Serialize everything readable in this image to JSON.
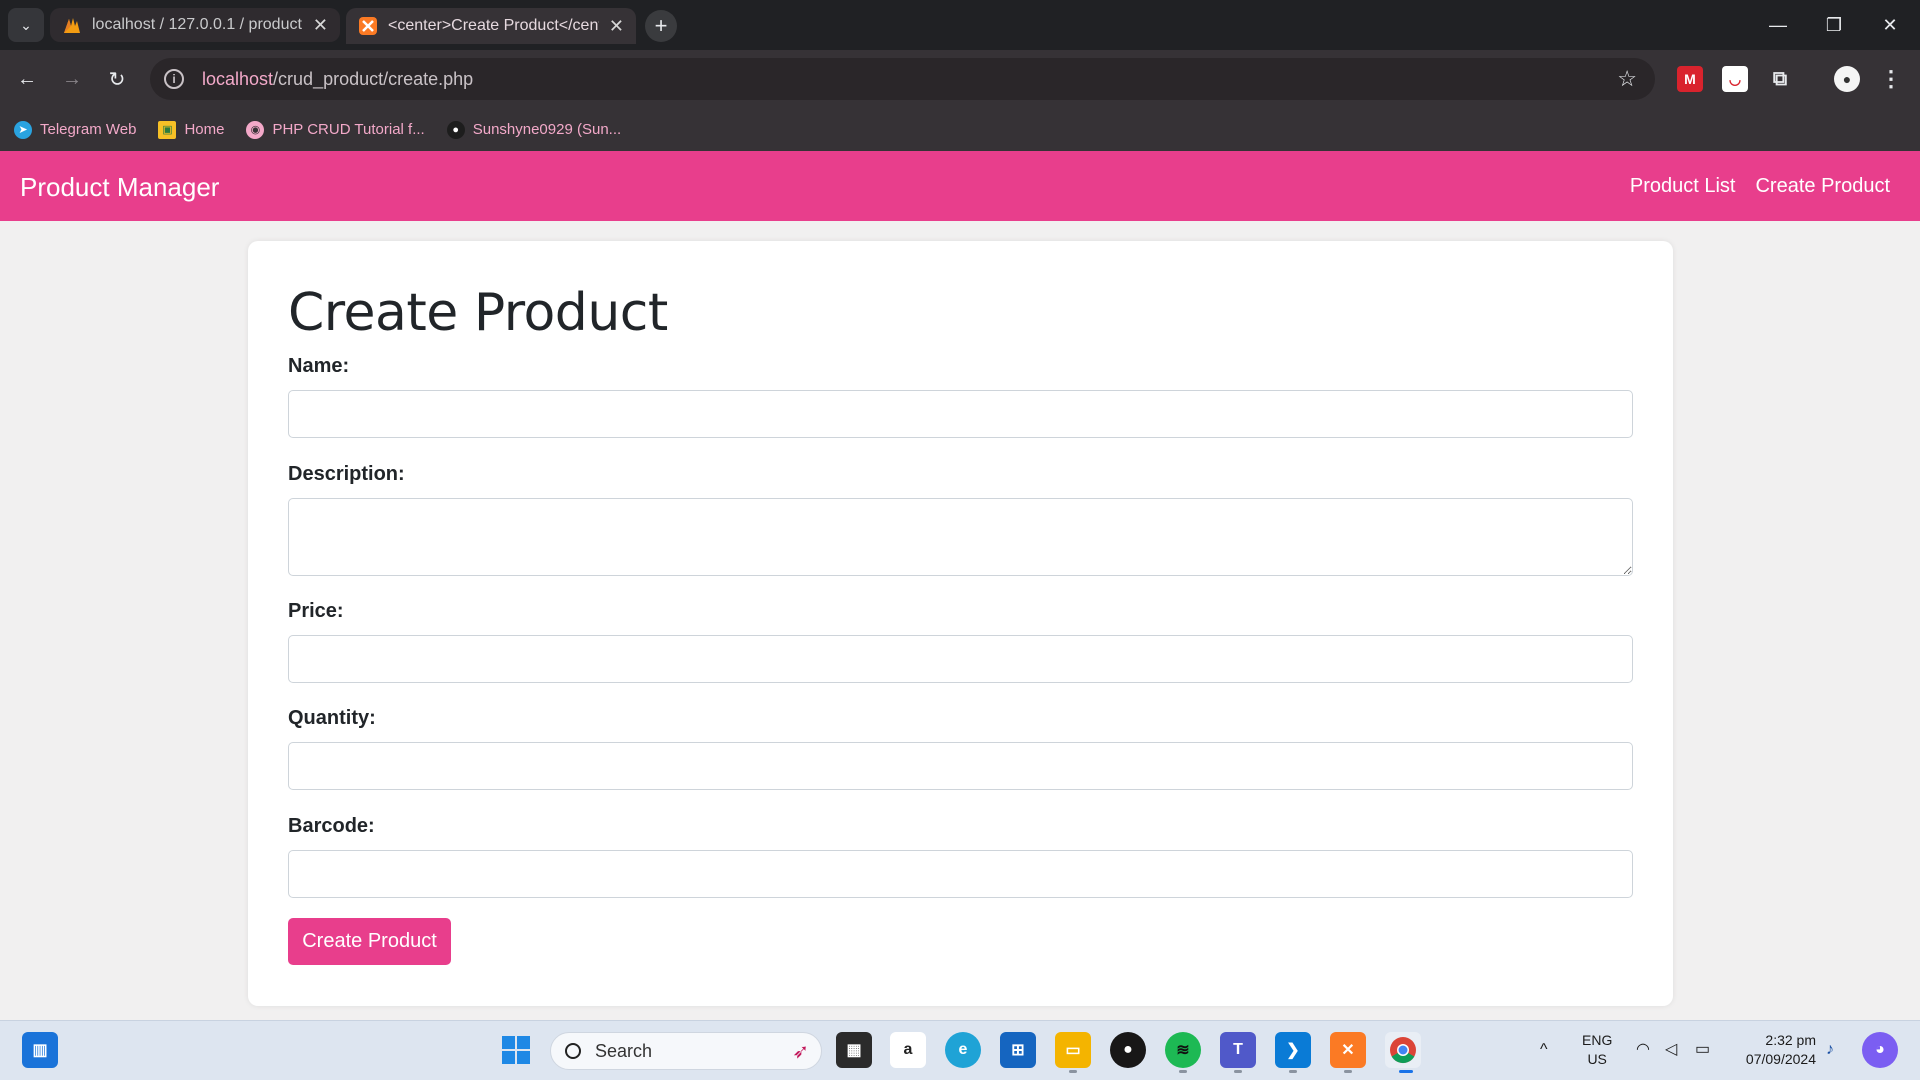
{
  "browser": {
    "tabs": [
      {
        "title": "localhost / 127.0.0.1 / product |",
        "active": false
      },
      {
        "title": "<center>Create Product</center>",
        "active": true
      }
    ],
    "url_host": "localhost",
    "url_path": "/crud_product/create.php",
    "bookmarks": [
      {
        "label": "Telegram Web",
        "icon": "telegram-icon"
      },
      {
        "label": "Home",
        "icon": "classroom-icon"
      },
      {
        "label": "PHP CRUD Tutorial f...",
        "icon": "globe-icon"
      },
      {
        "label": "Sunshyne0929 (Sun...",
        "icon": "github-icon"
      }
    ]
  },
  "navbar": {
    "brand": "Product Manager",
    "links": [
      "Product List",
      "Create Product"
    ]
  },
  "form": {
    "heading": "Create Product",
    "fields": [
      {
        "label": "Name:",
        "value": ""
      },
      {
        "label": "Description:",
        "value": ""
      },
      {
        "label": "Price:",
        "value": ""
      },
      {
        "label": "Quantity:",
        "value": ""
      },
      {
        "label": "Barcode:",
        "value": ""
      }
    ],
    "submit_label": "Create Product"
  },
  "taskbar": {
    "search_placeholder": "Search",
    "language": "ENG",
    "region": "US",
    "time": "2:32 pm",
    "date": "07/09/2024"
  },
  "colors": {
    "accent": "#e83e8c",
    "page_bg": "#f1f0f0"
  }
}
